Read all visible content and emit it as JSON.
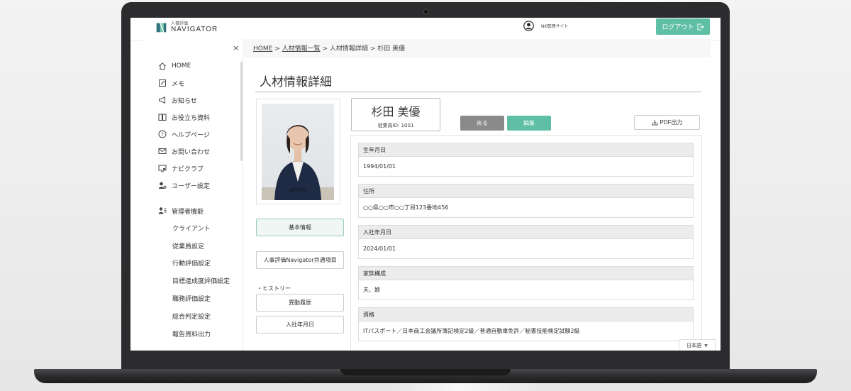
{
  "header": {
    "logo_small": "人事評価",
    "logo_big": "NAVIGATOR",
    "site_label": "NK管理サイト",
    "logout_label": "ログアウト"
  },
  "sidebar": {
    "close_glyph": "×",
    "items": [
      {
        "label": "HOME",
        "icon": "home-icon"
      },
      {
        "label": "メモ",
        "icon": "memo-icon"
      },
      {
        "label": "お知らせ",
        "icon": "megaphone-icon"
      },
      {
        "label": "お役立ち資料",
        "icon": "book-icon"
      },
      {
        "label": "ヘルプページ",
        "icon": "help-icon"
      },
      {
        "label": "お問い合わせ",
        "icon": "mail-icon"
      },
      {
        "label": "ナビクラブ",
        "icon": "club-icon"
      },
      {
        "label": "ユーザー設定",
        "icon": "user-settings-icon"
      }
    ],
    "admin": {
      "label": "管理者機能",
      "icon": "admin-icon",
      "sub_items": [
        "クライアント",
        "従業員設定",
        "行動評価設定",
        "目標達成度評価設定",
        "職務評価設定",
        "総合判定設定",
        "報告資料出力"
      ]
    }
  },
  "breadcrumb": {
    "home": "HOME",
    "list": "人材情報一覧",
    "detail": "人材情報詳細",
    "current": "杉田 美優",
    "sep": ">"
  },
  "page": {
    "title": "人材情報詳細"
  },
  "profile": {
    "name": "杉田 美優",
    "employee_id": "従業員ID: 1001"
  },
  "actions": {
    "back": "戻る",
    "edit": "編集",
    "pdf": "PDF出力"
  },
  "side_tabs": {
    "basic": "基本情報",
    "common": "人事評価Navigator共通項目",
    "history_heading": "・ヒストリー",
    "transfer": "異動履歴",
    "join_date": "入社年月日"
  },
  "fields": [
    {
      "label": "生年月日",
      "value": "1994/01/01"
    },
    {
      "label": "住所",
      "value": "○○県○○市○○丁目123番地456"
    },
    {
      "label": "入社年月日",
      "value": "2024/01/01"
    },
    {
      "label": "家族構成",
      "value": "夫、娘"
    },
    {
      "label": "資格",
      "value": "ITパスポート／日本商工会議所簿記検定2級／普通自動車免許／秘書技能検定試験2級"
    }
  ],
  "language": {
    "current": "日本語"
  },
  "colors": {
    "accent": "#5fbfa5",
    "back_button": "#8a8a8a",
    "laptop_frame": "#2c2c2e"
  }
}
